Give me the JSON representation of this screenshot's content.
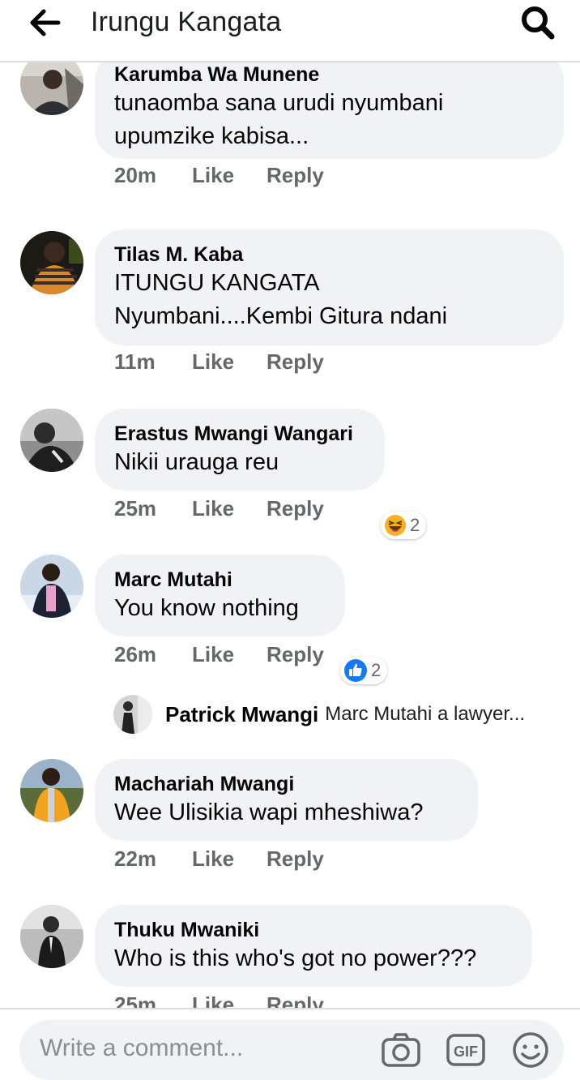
{
  "header": {
    "title": "Irungu Kangata"
  },
  "comments": [
    {
      "author": "Karumba Wa Munene",
      "text": "tunaomba sana urudi nyumbani\nupumzike kabisa...",
      "time": "20m",
      "like": "Like",
      "reply": "Reply"
    },
    {
      "author": "Tilas M. Kaba",
      "text": "ITUNGU KANGATA\nNyumbani....Kembi Gitura ndani",
      "time": "11m",
      "like": "Like",
      "reply": "Reply"
    },
    {
      "author": "Erastus Mwangi Wangari",
      "text": "Nikii urauga reu",
      "time": "25m",
      "like": "Like",
      "reply": "Reply",
      "reaction": {
        "icon": "haha-icon",
        "count": "2"
      }
    },
    {
      "author": "Marc Mutahi",
      "text": "You know nothing",
      "time": "26m",
      "like": "Like",
      "reply": "Reply",
      "reaction": {
        "icon": "like-icon",
        "count": "2"
      }
    },
    {
      "author": "Machariah Mwangi",
      "text": "Wee Ulisikia wapi mheshiwa?",
      "time": "22m",
      "like": "Like",
      "reply": "Reply"
    },
    {
      "author": "Thuku Mwaniki",
      "text": "Who is this who's got no power???",
      "time": "25m",
      "like": "Like",
      "reply": "Reply"
    }
  ],
  "reply_preview": {
    "author": "Patrick Mwangi",
    "text": "Marc Mutahi a lawyer..."
  },
  "composer": {
    "placeholder": "Write a comment..."
  },
  "colors": {
    "bubble": "#f0f2f5",
    "meta": "#65676b",
    "like_blue": "#1877f2",
    "haha_yellow": "#f7b125"
  }
}
